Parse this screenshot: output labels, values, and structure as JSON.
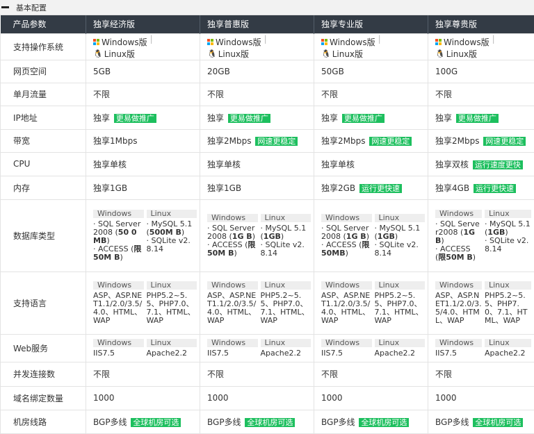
{
  "section": {
    "title": "基本配置"
  },
  "colors": {
    "header_bg": "#333b45",
    "tag_green": "#1dbf5e"
  },
  "headers": [
    "产品参数",
    "独享经济版",
    "独享普惠版",
    "独享专业版",
    "独享尊贵版"
  ],
  "rows": {
    "os": {
      "label": "支持操作系统",
      "windows": "Windows版",
      "linux": "Linux版"
    },
    "space": {
      "label": "网页空间",
      "values": [
        "5GB",
        "20GB",
        "50GB",
        "100G"
      ]
    },
    "traffic": {
      "label": "单月流量",
      "values": [
        "不限",
        "不限",
        "不限",
        "不限"
      ]
    },
    "ip": {
      "label": "IP地址",
      "value": "独享",
      "tag": "更易做推广"
    },
    "bandwidth": {
      "label": "带宽",
      "values": [
        "独享1Mbps",
        "独享2Mbps",
        "独享2Mbps",
        "独享2Mbps"
      ],
      "tags": [
        "",
        "网速更稳定",
        "网速更稳定",
        "网速更稳定"
      ]
    },
    "cpu": {
      "label": "CPU",
      "values": [
        "独享单核",
        "独享单核",
        "独享单核",
        "独享双核"
      ],
      "tags": [
        "",
        "",
        "",
        "运行速度更快"
      ]
    },
    "memory": {
      "label": "内存",
      "values": [
        "独享1GB",
        "独享1GB",
        "独享2GB",
        "独享4GB"
      ],
      "tags": [
        "",
        "",
        "运行更快速",
        "运行更快速"
      ]
    },
    "database": {
      "label": "数据库类型",
      "win_head": "Windows",
      "linux_head": "Linux",
      "cols": [
        {
          "w1": "SQL Server2008 (",
          "w1b": "50 0MB",
          "w1c": ")",
          "w2": "ACCESS (",
          "w2b": "限50M B",
          "w2c": ")",
          "l1": "MySQL 5.1 (",
          "l1b": "500M B",
          "l1c": ")",
          "l2": "SQLite v2.8.14"
        },
        {
          "w1": "SQL Server2008 (",
          "w1b": "1G B",
          "w1c": ")",
          "w2": "ACCESS (",
          "w2b": "限50M B",
          "w2c": ")",
          "l1": "MySQL 5.1 (",
          "l1b": "1GB",
          "l1c": ")",
          "l2": "SQLite v2.8.14"
        },
        {
          "w1": "SQL Server2008 (",
          "w1b": "1G B",
          "w1c": ")",
          "w2": "ACCESS (",
          "w2b": "限50MB",
          "w2c": ")",
          "l1": "MySQL 5.1 (",
          "l1b": "1GB",
          "l1c": ")",
          "l2": "SQLite v2.8.14"
        },
        {
          "w1": "SQL Server2008 (",
          "w1b": "1G B",
          "w1c": ")",
          "w2": "ACCESS (",
          "w2b": "限50M B",
          "w2c": ")",
          "l1": "MySQL 5.1 (",
          "l1b": "1GB",
          "l1c": ")",
          "l2": "SQLite v2.8.14"
        }
      ]
    },
    "language": {
      "label": "支持语言",
      "win": "ASP、ASP.NET1.1/2.0/3.5/4.0、HTML、WAP",
      "linux": "PHP5.2~5.5、PHP7.0、7.1、HTML、WAP"
    },
    "web": {
      "label": "Web服务",
      "win": "IIS7.5",
      "linux": "Apache2.2"
    },
    "conn": {
      "label": "并发连接数",
      "values": [
        "不限",
        "不限",
        "不限",
        "不限"
      ]
    },
    "domain": {
      "label": "域名绑定数量",
      "values": [
        "1000",
        "1000",
        "1000",
        "1000"
      ]
    },
    "line": {
      "label": "机房线路",
      "value": "BGP多线",
      "tag": "全球机房可选"
    }
  }
}
